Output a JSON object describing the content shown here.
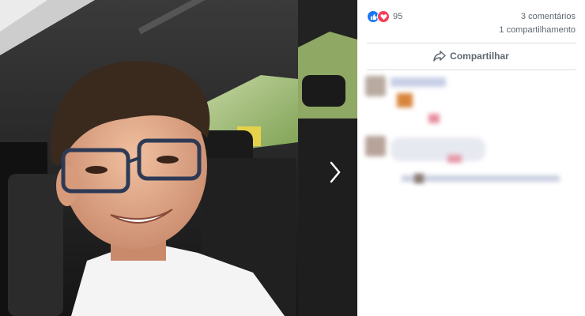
{
  "post": {
    "reaction_count": "95",
    "comments_label": "3 comentários",
    "shares_label": "1 compartilhamento",
    "share_button_label": "Compartilhar"
  },
  "icons": {
    "like": "like-icon",
    "love": "heart-icon",
    "share": "share-arrow-icon",
    "next": "chevron-right-icon"
  },
  "colors": {
    "like": "#1877f2",
    "love": "#f33e58",
    "text_secondary": "#606770",
    "divider": "#dadde1"
  }
}
